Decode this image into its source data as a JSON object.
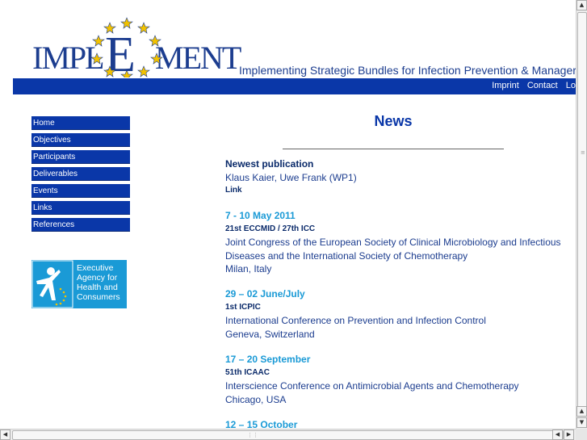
{
  "header": {
    "logo_text": "IMPLEMENT",
    "tagline": "Implementing Strategic Bundles for Infection Prevention & Manager"
  },
  "top_links": [
    {
      "label": "Imprint"
    },
    {
      "label": "Contact"
    },
    {
      "label": "Lo"
    }
  ],
  "side_menu": [
    {
      "label": "Home"
    },
    {
      "label": "Objectives"
    },
    {
      "label": "Participants"
    },
    {
      "label": "Deliverables"
    },
    {
      "label": "Events"
    },
    {
      "label": "Links"
    },
    {
      "label": "References"
    }
  ],
  "agency_logo": {
    "line1": "Executive",
    "line2": "Agency for",
    "line3": "Health and",
    "line4": "Consumers"
  },
  "content": {
    "title": "News",
    "newest": {
      "heading": "Newest publication",
      "authors": "Klaus Kaier, Uwe Frank (WP1)",
      "link": "Link"
    },
    "events": [
      {
        "date": "7 - 10 May 2011",
        "acronym": "21st ECCMID / 27th ICC",
        "line1": "Joint Congress of the European Society of Clinical Microbiology and Infectious",
        "line2": "Diseases and the International Society of Chemotherapy",
        "location": "Milan, Italy"
      },
      {
        "date": "29 – 02 June/July",
        "acronym": "1st ICPIC",
        "line1": "International Conference on Prevention and Infection Control",
        "location": "Geneva, Switzerland"
      },
      {
        "date": "17 – 20 September",
        "acronym": "51th ICAAC",
        "line1": "Interscience Conference on Antimicrobial Agents and Chemotherapy",
        "location": "Chicago, USA"
      },
      {
        "date": "12 – 15 October"
      }
    ]
  },
  "colors": {
    "nav_blue": "#0a37a8",
    "date_cyan": "#1a9ad6",
    "text_blue": "#1c3d8f"
  }
}
